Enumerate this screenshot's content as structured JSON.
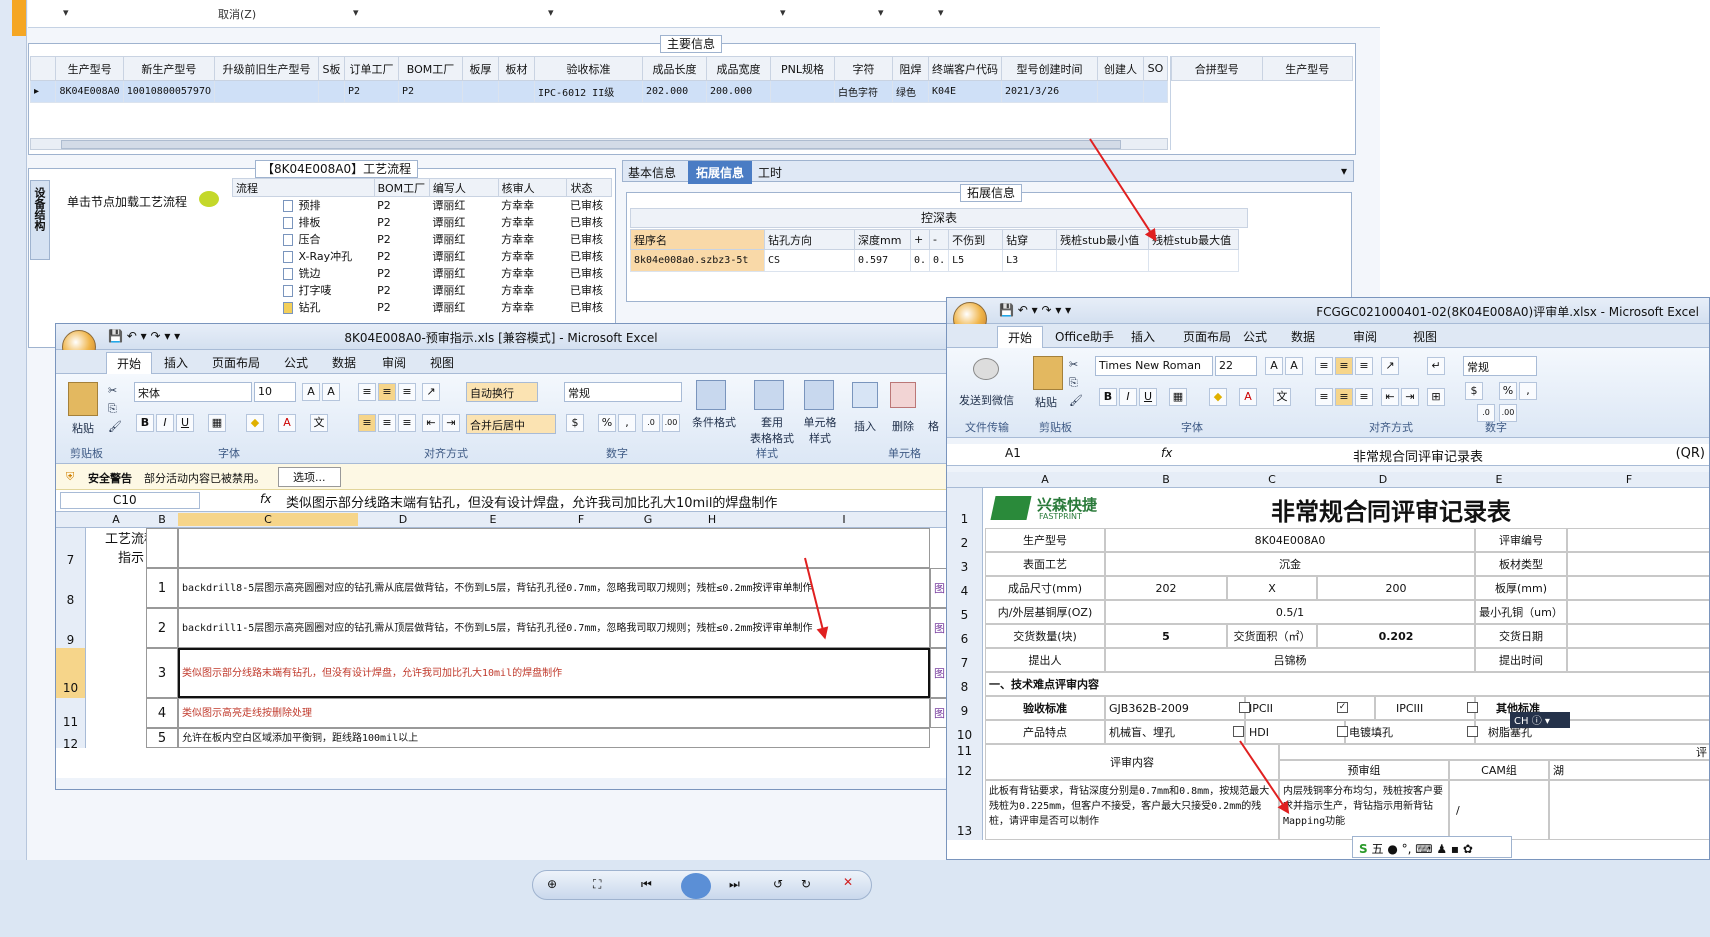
{
  "top": {
    "cancel": "取消(Z)"
  },
  "main_info": {
    "legend": "主要信息",
    "columns": [
      "生产型号",
      "新生产型号",
      "升级前旧生产型号",
      "S板",
      "订单工厂",
      "BOM工厂",
      "板厚",
      "板材",
      "验收标准",
      "成品长度",
      "成品宽度",
      "PNL规格",
      "字符",
      "阻焊",
      "终端客户代码",
      "型号创建时间",
      "创建人",
      "SO"
    ],
    "row": [
      "8K04E008A0",
      "1001080005797O",
      "",
      "",
      "P2",
      "P2",
      "",
      "",
      "IPC-6012 II级",
      "202.000",
      "200.000",
      "",
      "白色字符",
      "绿色",
      "K04E",
      "2021/3/26",
      "",
      ""
    ],
    "side_cols": [
      "合拼型号",
      "生产型号"
    ]
  },
  "process": {
    "legend": "【8K04E008A0】工艺流程",
    "side_tab": "设备结构",
    "hint": "单击节点加载工艺流程",
    "columns": [
      "流程",
      "BOM工厂",
      "编写人",
      "核审人",
      "状态"
    ],
    "rows": [
      [
        "预排",
        "P2",
        "谭丽红",
        "方幸幸",
        "已审核"
      ],
      [
        "排板",
        "P2",
        "谭丽红",
        "方幸幸",
        "已审核"
      ],
      [
        "压合",
        "P2",
        "谭丽红",
        "方幸幸",
        "已审核"
      ],
      [
        "X-Ray冲孔",
        "P2",
        "谭丽红",
        "方幸幸",
        "已审核"
      ],
      [
        "铣边",
        "P2",
        "谭丽红",
        "方幸幸",
        "已审核"
      ],
      [
        "打字唛",
        "P2",
        "谭丽红",
        "方幸幸",
        "已审核"
      ],
      [
        "钻孔",
        "P2",
        "谭丽红",
        "方幸幸",
        "已审核"
      ]
    ]
  },
  "ext": {
    "tabs": [
      "基本信息",
      "拓展信息",
      "工时"
    ],
    "legend": "拓展信息",
    "subtitle": "控深表",
    "columns": [
      "程序名",
      "钻孔方向",
      "深度mm",
      "+",
      "-",
      "不伤到",
      "钻穿",
      "残桩stub最小值",
      "残桩stub最大值"
    ],
    "row": [
      "8k04e008a0.szbz3-5t",
      "CS",
      "0.597",
      "0.",
      "0.",
      "L5",
      "L3",
      "",
      ""
    ]
  },
  "excel1": {
    "title": "8K04E008A0-预审指示.xls [兼容模式] - Microsoft Excel",
    "tabs": [
      "开始",
      "插入",
      "页面布局",
      "公式",
      "数据",
      "审阅",
      "视图"
    ],
    "font": "宋体",
    "size": "10",
    "wrap": "自动换行",
    "merge": "合并后居中",
    "numfmt": "常规",
    "groups": [
      "剪贴板",
      "字体",
      "对齐方式",
      "数字",
      "样式",
      "单元格"
    ],
    "btns": {
      "paste": "粘贴",
      "cond": "条件格式",
      "table": "套用\n表格格式",
      "cellstyle": "单元格\n样式",
      "insert": "插入",
      "delete": "删除",
      "fmt": "格"
    },
    "warn_title": "安全警告",
    "warn_text": "部分活动内容已被禁用。",
    "warn_btn": "选项...",
    "namebox": "C10",
    "formula": "类似图示部分线路末端有钻孔，但没有设计焊盘，允许我司加比孔大10mil的焊盘制作",
    "cols": [
      "A",
      "B",
      "C",
      "D",
      "E",
      "F",
      "G",
      "H",
      "I"
    ],
    "rows": [
      {
        "r": "7",
        "a": "工艺流程\n指示",
        "b": "",
        "c": ""
      },
      {
        "r": "8",
        "a": "",
        "b": "1",
        "c": "backdrill8-5层图示高亮圆圈对应的钻孔需从底层做背钻，不伤到L5层，背钻孔孔径0.7mm，忽略我司取刀规则；残桩≤0.2mm按评审单制作"
      },
      {
        "r": "9",
        "a": "",
        "b": "2",
        "c": "backdrill1-5层图示高亮圆圈对应的钻孔需从顶层做背钻，不伤到L5层，背钻孔孔径0.7mm，忽略我司取刀规则；残桩≤0.2mm按评审单制作"
      },
      {
        "r": "10",
        "a": "",
        "b": "3",
        "c": "类似图示部分线路末端有钻孔，但没有设计焊盘，允许我司加比孔大10mil的焊盘制作"
      },
      {
        "r": "11",
        "a": "",
        "b": "4",
        "c": "类似图示高亮走线按删除处理"
      },
      {
        "r": "12",
        "a": "",
        "b": "5",
        "c": "允许在板内空白区域添加平衡铜，距线路100mil以上"
      }
    ],
    "img": "图"
  },
  "excel2": {
    "title": "FCGGC021000401-02(8K04E008A0)评审单.xlsx - Microsoft Excel",
    "tabs": [
      "开始",
      "Office助手",
      "插入",
      "页面布局",
      "公式",
      "数据",
      "审阅",
      "视图"
    ],
    "send": "发送到微信",
    "paste": "粘贴",
    "font": "Times New Roman",
    "size": "22",
    "numfmt": "常规",
    "groups": [
      "文件传输",
      "剪贴板",
      "字体",
      "对齐方式",
      "数字"
    ],
    "namebox": "A1",
    "formula": "非常规合同评审记录表",
    "qr": "(QR)",
    "cols": [
      "A",
      "B",
      "C",
      "D",
      "E",
      "F"
    ],
    "logo": "兴森快捷",
    "logo_en": "FASTPRINT",
    "sheet_title": "非常规合同评审记录表",
    "r2": [
      "生产型号",
      "8K04E008A0",
      "评审编号"
    ],
    "r3": [
      "表面工艺",
      "沉金",
      "板材类型"
    ],
    "r4": [
      "成品尺寸(mm)",
      "202",
      "X",
      "200",
      "板厚(mm)"
    ],
    "r5": [
      "内/外层基铜厚(OZ)",
      "0.5/1",
      "最小孔铜（um）"
    ],
    "r6": [
      "交货数量(块)",
      "5",
      "交货面积（㎡）",
      "0.202",
      "交货日期"
    ],
    "r7": [
      "提出人",
      "吕锦杨",
      "提出时间"
    ],
    "r8": "一、技术难点评审内容",
    "r9": [
      "验收标准",
      "GJB362B-2009",
      "IPCII",
      "IPCIII",
      "其他标准"
    ],
    "r10": [
      "产品特点",
      "机械盲、埋孔",
      "HDI",
      "电镀填孔",
      "树脂塞孔"
    ],
    "r11": [
      "评审内容",
      "评"
    ],
    "r12": [
      "预审组",
      "CAM组",
      "湖"
    ],
    "r13a": "此板有背钻要求，背钻深度分别是0.7mm和0.8mm，按规范最大残桩为0.225mm，但客户不接受，客户最大只接受0.2mm的残桩，请评审是否可以制作",
    "r13b": "内层残铜率分布均匀，残桩按客户要求并指示生产，背钻指示用新背钻Mapping功能",
    "r13c": "/",
    "rownums": [
      "1",
      "2",
      "3",
      "4",
      "5",
      "6",
      "7",
      "8",
      "9",
      "10",
      "11",
      "12",
      "13"
    ],
    "ime": "CH",
    "ime2": "五"
  }
}
